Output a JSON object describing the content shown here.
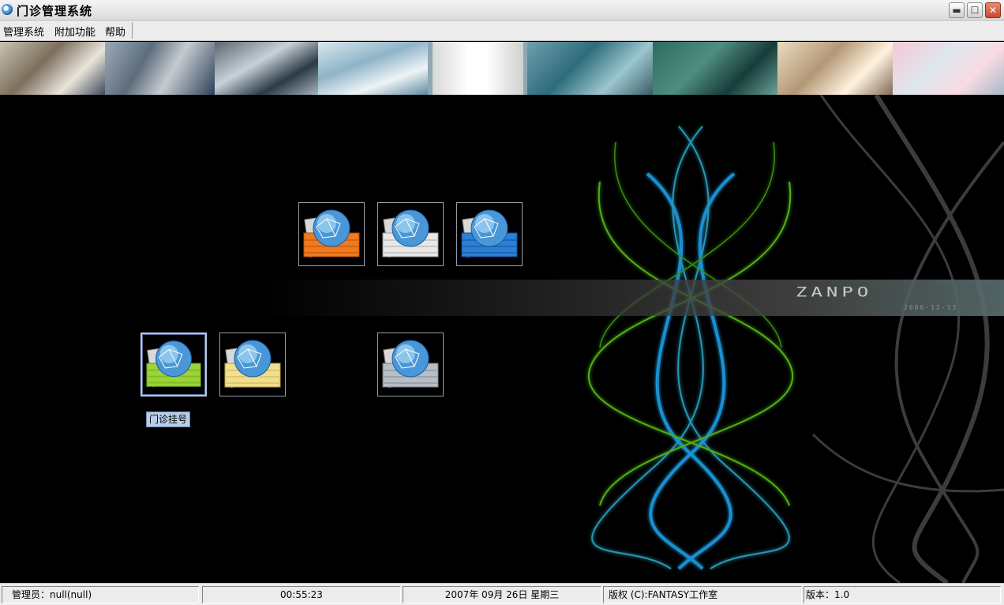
{
  "window": {
    "title": "门诊管理系统",
    "app_icon": "app-logo-icon",
    "controls": {
      "minimize": "minimize-icon",
      "maximize": "maximize-icon",
      "close": "close-icon"
    }
  },
  "menu": {
    "items": [
      {
        "label": "管理系统"
      },
      {
        "label": "附加功能"
      },
      {
        "label": "帮助"
      }
    ]
  },
  "banner": {
    "photos": [
      "clinic-photo",
      "surgery-photo",
      "equipment-photo",
      "dental-photo",
      "red-cross-logo",
      "operating-room-photo",
      "surgery-team-photo",
      "consultation-photo",
      "nursing-photo"
    ],
    "accent_color": "#e1141b"
  },
  "desktop": {
    "background": "#000000",
    "brand": {
      "text": "ZANPO",
      "date": "2006-12-13"
    },
    "icons": [
      {
        "name": "globe-document-icon",
        "color": "#f07a1e"
      },
      {
        "name": "globe-document-icon",
        "color": "#e8e8e8"
      },
      {
        "name": "globe-document-icon",
        "color": "#2b7fd6"
      },
      {
        "name": "globe-document-icon",
        "color": "#9bd33a"
      },
      {
        "name": "globe-document-icon",
        "color": "#f0df8f"
      },
      {
        "name": "globe-document-icon",
        "color": "#b8bec6"
      }
    ],
    "selected_icon_label": "门诊挂号"
  },
  "status": {
    "user": "管理员：null(null)",
    "time": "00:55:23",
    "date": "2007年 09月 26日 星期三",
    "copyright": "版权 (C):FANTASY工作室",
    "version": "版本：1.0"
  }
}
